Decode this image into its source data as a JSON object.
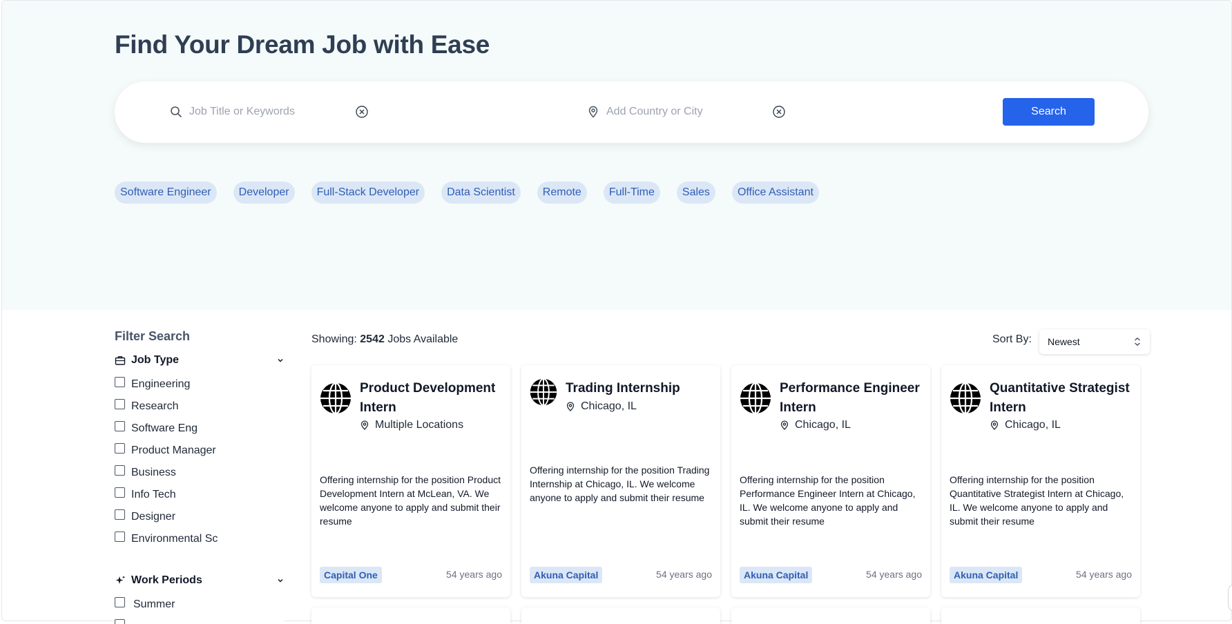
{
  "hero": {
    "title": "Find Your Dream Job with Ease"
  },
  "search": {
    "keywords_placeholder": "Job Title or Keywords",
    "keywords_value": "",
    "location_placeholder": "Add Country or City",
    "location_value": "",
    "button_label": "Search"
  },
  "tags": [
    "Software Engineer",
    "Developer",
    "Full-Stack Developer",
    "Data Scientist",
    "Remote",
    "Full-Time",
    "Sales",
    "Office Assistant"
  ],
  "filters": {
    "title": "Filter Search",
    "job_type": {
      "label": "Job Type",
      "options": [
        "Engineering",
        "Research",
        "Software Eng",
        "Product Manager",
        "Business",
        "Info Tech",
        "Designer",
        "Environmental Sc"
      ]
    },
    "work_periods": {
      "label": "Work Periods",
      "options": [
        "Summer"
      ]
    }
  },
  "results": {
    "showing_prefix": "Showing:",
    "count": "2542",
    "suffix": "Jobs Available",
    "sort_label": "Sort By:",
    "sort_value": "Newest"
  },
  "jobs": [
    {
      "title": "Product Development Intern",
      "location": "Multiple Locations",
      "description": "Offering internship for the position Product Development Intern at McLean, VA. We welcome anyone to apply and submit their resume",
      "company": "Capital One",
      "age": "54 years ago"
    },
    {
      "title": "Trading Internship",
      "location": "Chicago, IL",
      "description": "Offering internship for the position Trading Internship at Chicago, IL. We welcome anyone to apply and submit their resume",
      "company": "Akuna Capital",
      "age": "54 years ago"
    },
    {
      "title": "Performance Engineer Intern",
      "location": "Chicago, IL",
      "description": "Offering internship for the position Performance Engineer Intern at Chicago, IL. We welcome anyone to apply and submit their resume",
      "company": "Akuna Capital",
      "age": "54 years ago"
    },
    {
      "title": "Quantitative Strategist Intern",
      "location": "Chicago, IL",
      "description": "Offering internship for the position Quantitative Strategist Intern at Chicago, IL. We welcome anyone to apply and submit their resume",
      "company": "Akuna Capital",
      "age": "54 years ago"
    }
  ],
  "colors": {
    "accent": "#2563eb",
    "tag_bg": "#dbe7f6",
    "tag_text": "#2f5db6",
    "hero_bg": "#f5fbfb",
    "title_text": "#2f3e53"
  },
  "icons": {
    "search": "search-icon",
    "location": "map-pin-icon",
    "clear": "clear-x-circle-icon",
    "job_type": "briefcase-icon",
    "work_periods": "sparkle-icon",
    "chevron": "chevron-down-icon",
    "company_logo": "globe-icon",
    "sort": "up-down-chevron-icon"
  }
}
